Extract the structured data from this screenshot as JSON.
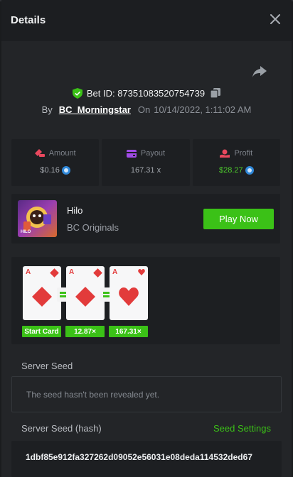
{
  "header": {
    "title": "Details",
    "close_icon": "close-icon"
  },
  "bet": {
    "id_label": "Bet ID: 87351083520754739",
    "by_label": "By",
    "username": "BC_Morningstar",
    "on_label": "On",
    "datetime": "10/14/2022, 1:11:02 AM"
  },
  "stats": {
    "amount": {
      "label": "Amount",
      "value": "$0.16"
    },
    "payout": {
      "label": "Payout",
      "value": "167.31 x"
    },
    "profit": {
      "label": "Profit",
      "value": "$28.27"
    }
  },
  "game": {
    "thumb_label": "HILO",
    "name": "Hilo",
    "provider": "BC Originals",
    "play_button": "Play Now"
  },
  "cards": [
    {
      "rank": "A",
      "suit": "diamond",
      "tag": "Start Card"
    },
    {
      "rank": "A",
      "suit": "diamond",
      "tag": "12.87×"
    },
    {
      "rank": "A",
      "suit": "heart",
      "tag": "167.31×"
    }
  ],
  "seeds": {
    "server_seed_label": "Server Seed",
    "server_seed_value": "The seed hasn't been revealed yet.",
    "server_hash_label": "Server Seed (hash)",
    "seed_settings_link": "Seed Settings",
    "server_hash_value": "1dbf85e912fa327262d09052e56031e08deda114532ded67"
  },
  "colors": {
    "accent_green": "#3bc117",
    "profit_green": "#4dcb2d",
    "card_red": "#e23b3b",
    "panel_bg": "#232528",
    "tile_bg": "#1d1f22"
  }
}
